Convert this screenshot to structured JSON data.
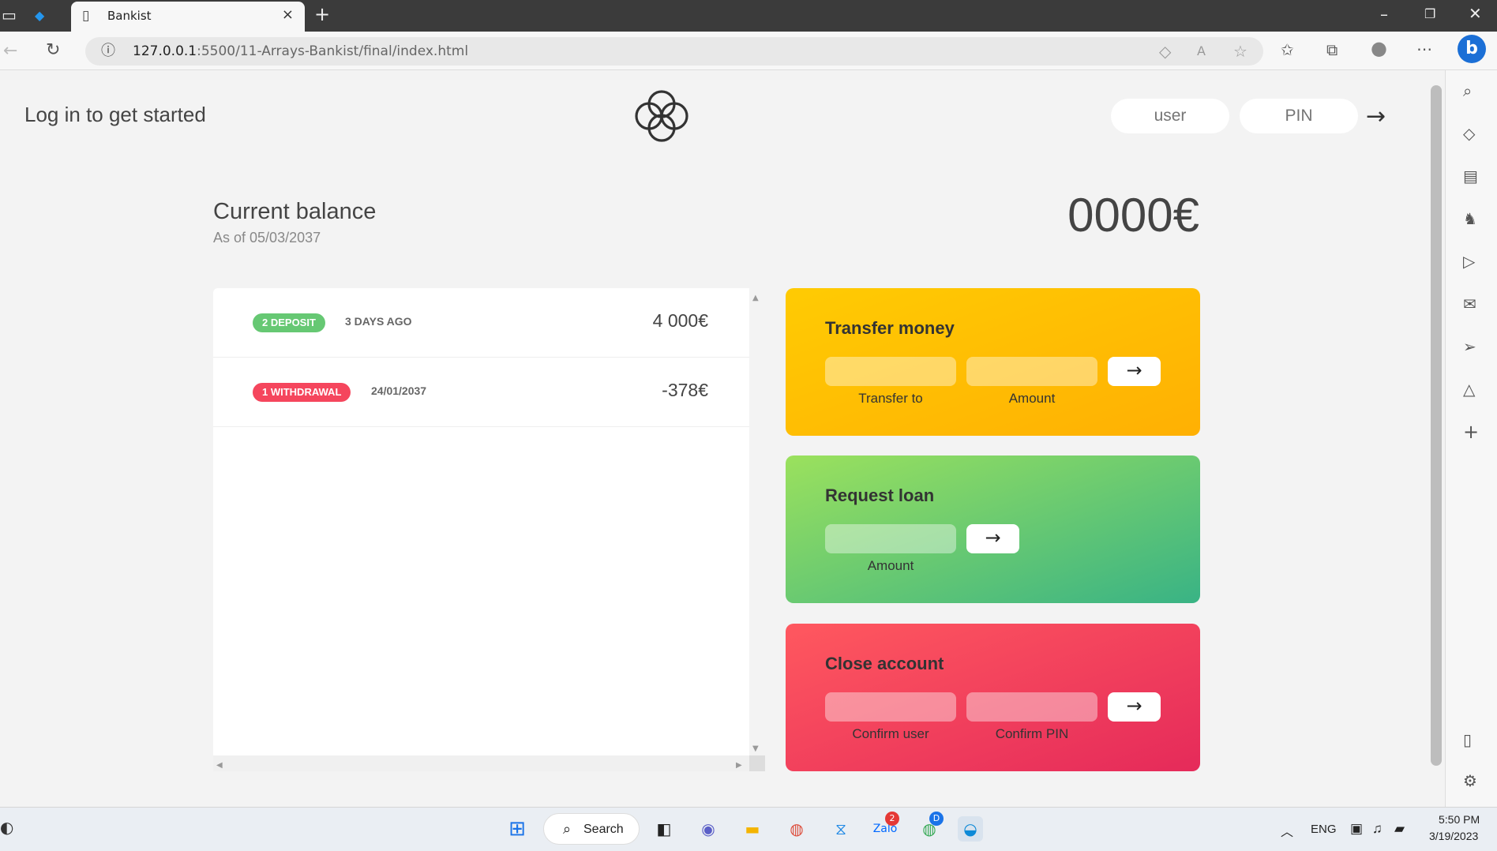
{
  "browser": {
    "tab_title": "Bankist",
    "url_host": "127.0.0.1",
    "url_rest": ":5500/11-Arrays-Bankist/final/index.html",
    "icons": [
      "sidebar-toggle-icon",
      "docker-icon",
      "page-icon",
      "close-icon",
      "plus-icon",
      "minimize-icon",
      "restore-icon",
      "close-window-icon",
      "back-icon",
      "refresh-icon",
      "info-icon",
      "tag-icon",
      "read-aloud-icon",
      "favorite-add-icon",
      "favorites-icon",
      "collections-icon",
      "profile-icon",
      "more-icon",
      "bing-icon"
    ]
  },
  "sidebar": {
    "icons": [
      "search-icon",
      "shopping-icon",
      "tools-icon",
      "games-icon",
      "office-icon",
      "outlook-icon",
      "send-icon",
      "drop-icon",
      "add-icon",
      "split-screen-icon",
      "settings-icon"
    ]
  },
  "nav": {
    "welcome": "Log in to get started",
    "user_placeholder": "user",
    "pin_placeholder": "PIN",
    "login_arrow": "→"
  },
  "balance": {
    "label": "Current balance",
    "date_prefix": "As of ",
    "date": "05/03/2037",
    "value": "0000€"
  },
  "movements": [
    {
      "badge": "2 DEPOSIT",
      "type": "deposit",
      "date": "3 DAYS AGO",
      "value": "4 000€"
    },
    {
      "badge": "1 WITHDRAWAL",
      "type": "withdrawal",
      "date": "24/01/2037",
      "value": "-378€"
    }
  ],
  "operations": {
    "transfer": {
      "title": "Transfer money",
      "label_to": "Transfer to",
      "label_amount": "Amount",
      "button": "→"
    },
    "loan": {
      "title": "Request loan",
      "label_amount": "Amount",
      "button": "→"
    },
    "close": {
      "title": "Close account",
      "label_user": "Confirm user",
      "label_pin": "Confirm PIN",
      "button": "→"
    }
  },
  "taskbar": {
    "search_label": "Search",
    "zalo_badge": "2",
    "chrome_badge": "D",
    "lang": "ENG",
    "time": "5:50 PM",
    "date": "3/19/2023"
  },
  "colors": {
    "deposit": "#66c873",
    "withdrawal": "#f5465d",
    "transfer": "#ffb003",
    "loan": "#39b385",
    "close": "#e52a5a"
  }
}
